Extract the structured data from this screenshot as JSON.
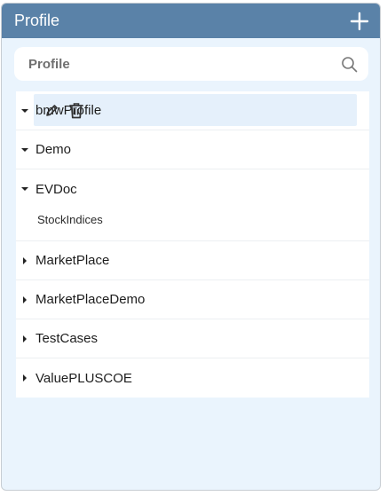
{
  "header": {
    "title": "Profile"
  },
  "search": {
    "placeholder": "Profile"
  },
  "tree": [
    {
      "label": "bmwProfile",
      "expanded": true,
      "selected": true,
      "children": []
    },
    {
      "label": "Demo",
      "expanded": true,
      "children": []
    },
    {
      "label": "EVDoc",
      "expanded": true,
      "children": [
        "StockIndices"
      ]
    },
    {
      "label": "MarketPlace",
      "expanded": false
    },
    {
      "label": "MarketPlaceDemo",
      "expanded": false
    },
    {
      "label": "TestCases",
      "expanded": false
    },
    {
      "label": "ValuePLUSCOE",
      "expanded": false
    }
  ],
  "colors": {
    "header": "#5a82a8",
    "panel": "#eaf4fd",
    "selected": "#e5f0fb"
  }
}
